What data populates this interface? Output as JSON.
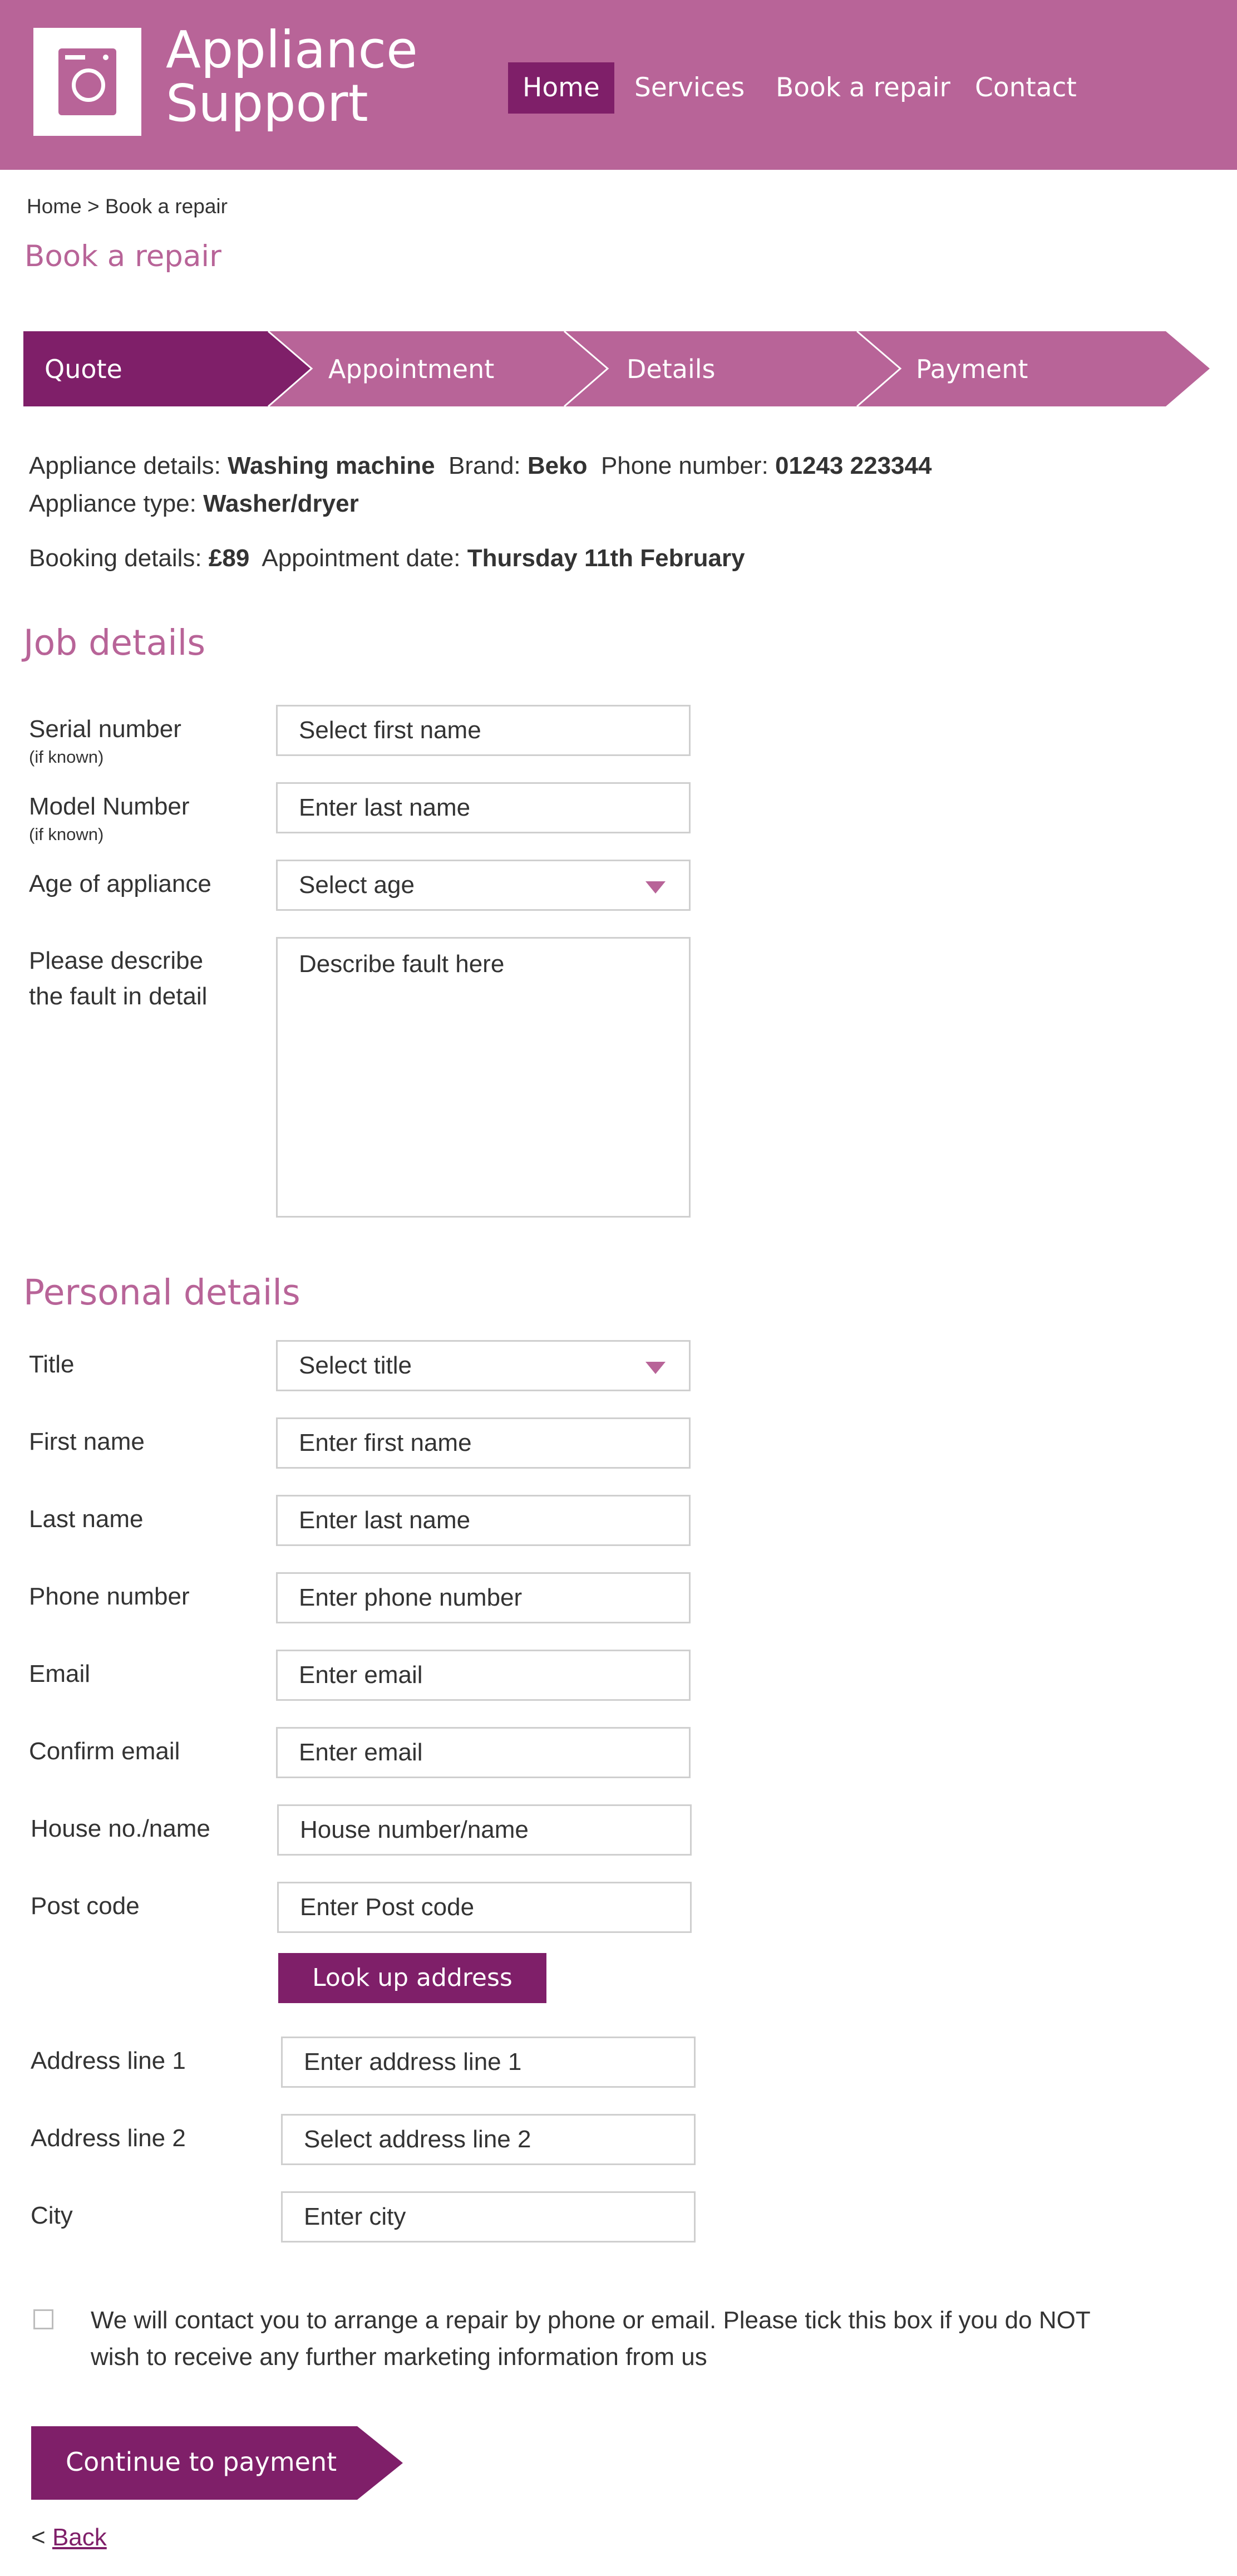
{
  "header": {
    "brand_line1": "Appliance",
    "brand_line2": "Support",
    "nav": [
      "Home",
      "Services",
      "Book a repair",
      "Contact"
    ],
    "active_nav": "Home"
  },
  "breadcrumb": {
    "home": "Home",
    "sep": ">",
    "current": "Book a repair"
  },
  "page_title": "Book a repair",
  "steps": [
    "Quote",
    "Appointment",
    "Details",
    "Payment"
  ],
  "active_step": "Quote",
  "summary": {
    "appliance_details_label": "Appliance details:",
    "appliance_details_value": "Washing machine",
    "brand_label": "Brand:",
    "brand_value": "Beko",
    "phone_label": "Phone number:",
    "phone_value": "01243 223344",
    "type_label": "Appliance type:",
    "type_value": "Washer/dryer",
    "booking_label": "Booking details:",
    "booking_value": "£89",
    "date_label": "Appointment date:",
    "date_value": "Thursday 11th February"
  },
  "job_details": {
    "heading": "Job details",
    "serial_label": "Serial number",
    "serial_hint": "(if known)",
    "serial_placeholder": "Select first name",
    "model_label": "Model Number",
    "model_hint": "(if known)",
    "model_placeholder": "Enter last name",
    "age_label": "Age of appliance",
    "age_value": "Select age",
    "fault_label_1": "Please describe",
    "fault_label_2": "the fault in detail",
    "fault_placeholder": "Describe fault here"
  },
  "personal_details": {
    "heading": "Personal details",
    "title_label": "Title",
    "title_value": "Select title",
    "fields": [
      {
        "label": "First name",
        "placeholder": "Enter first name"
      },
      {
        "label": "Last name",
        "placeholder": "Enter last name"
      },
      {
        "label": "Phone number",
        "placeholder": "Enter phone number"
      },
      {
        "label": "Email",
        "placeholder": "Enter email"
      },
      {
        "label": "Confirm email",
        "placeholder": "Enter email"
      },
      {
        "label": "House no./name",
        "placeholder": "House number/name"
      },
      {
        "label": "Post code",
        "placeholder": "Enter Post code"
      }
    ],
    "lookup_label": "Look up address",
    "address_fields": [
      {
        "label": "Address line 1",
        "placeholder": "Enter address line 1"
      },
      {
        "label": "Address line 2",
        "placeholder": "Select address line 2"
      },
      {
        "label": "City",
        "placeholder": "Enter city"
      }
    ]
  },
  "consent": {
    "line1": "We will contact you to arrange a repair by phone or email. Please tick this box if you do NOT",
    "line2": "wish to receive any further marketing information from us",
    "checked": false
  },
  "continue_label": "Continue to payment",
  "back": {
    "prefix": "<",
    "label": "Back"
  },
  "colors": {
    "header": "#b86498",
    "accent_dark": "#7f1f69",
    "field_border": "#cfcfcf"
  },
  "icons": {
    "logo": "washing-machine-icon",
    "dropdown": "triangle-down-icon",
    "checkbox": "checkbox-unchecked-icon"
  }
}
